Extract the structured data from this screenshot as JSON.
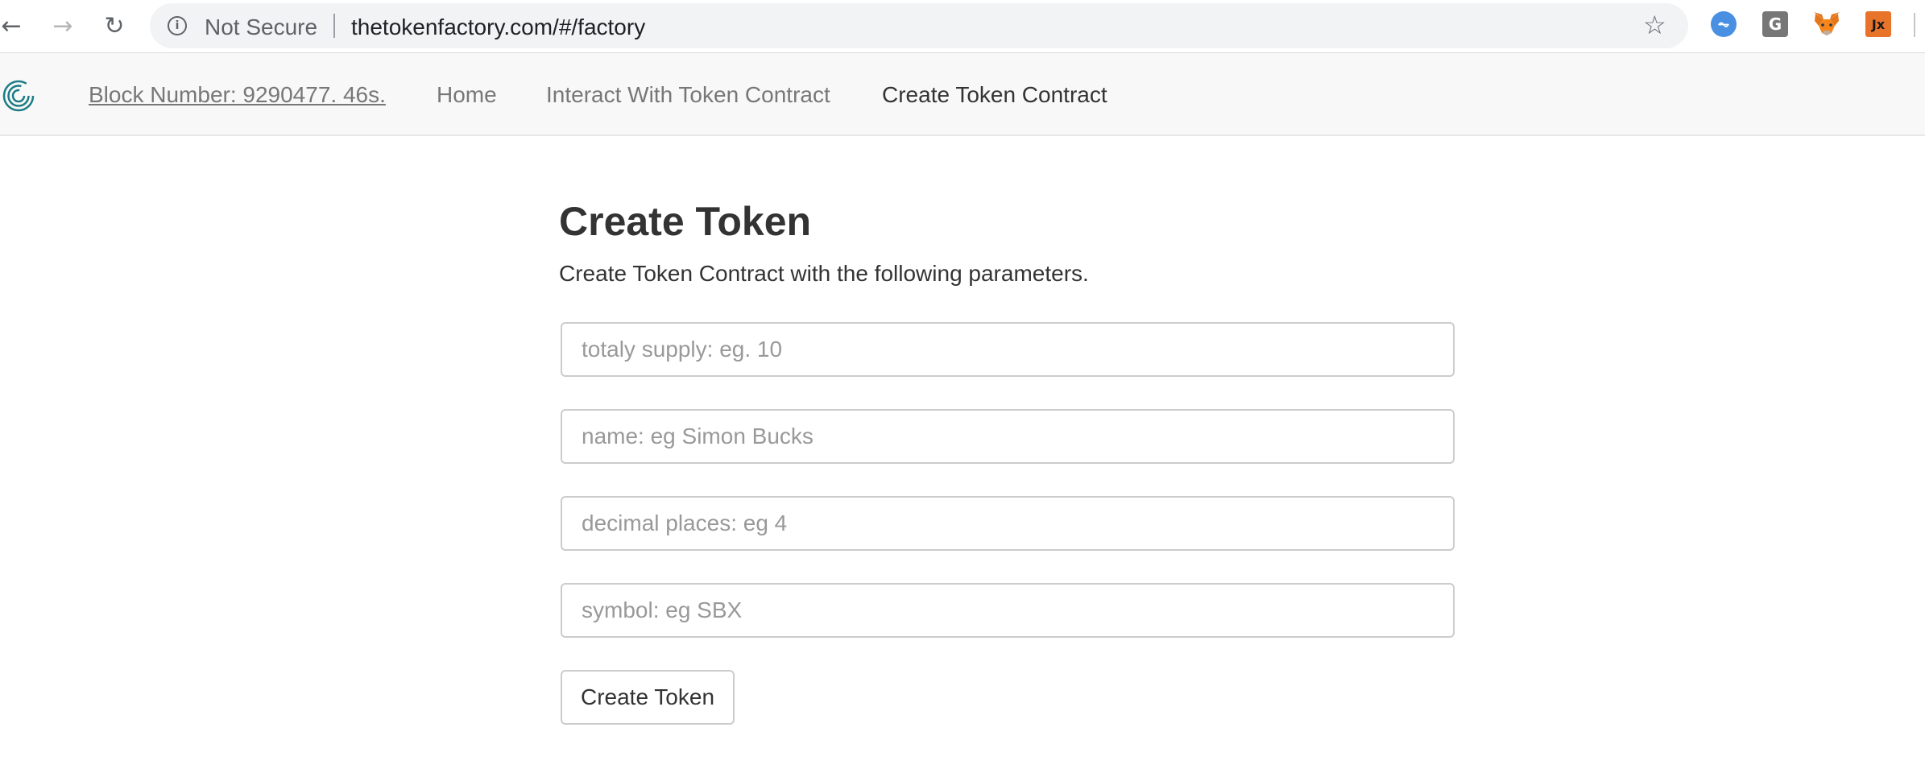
{
  "browser": {
    "back_icon": "←",
    "forward_icon": "→",
    "reload_icon": "↻",
    "security_label": "Not Secure",
    "url": "thetokenfactory.com/#/factory",
    "star_icon": "☆",
    "extensions": [
      {
        "name": "pulse-extension",
        "glyph": "⏦"
      },
      {
        "name": "grammarly-extension",
        "glyph": "G"
      },
      {
        "name": "metamask-extension",
        "glyph": ""
      },
      {
        "name": "jx-extension",
        "glyph": "Jx"
      }
    ]
  },
  "navbar": {
    "block_number": "Block Number: 9290477. 46s.",
    "links": [
      {
        "label": "Home"
      },
      {
        "label": "Interact With Token Contract"
      },
      {
        "label": "Create Token Contract"
      }
    ]
  },
  "form": {
    "title": "Create Token",
    "subtitle": "Create Token Contract with the following parameters.",
    "fields": [
      {
        "placeholder": "totaly supply: eg. 10"
      },
      {
        "placeholder": "name: eg Simon Bucks"
      },
      {
        "placeholder": "decimal places: eg 4"
      },
      {
        "placeholder": "symbol: eg SBX"
      }
    ],
    "submit_label": "Create Token"
  },
  "colors": {
    "navbar_bg": "#f8f8f8",
    "link_color": "#777777",
    "text_color": "#333333",
    "logo_color": "#1c7c86",
    "metamask_orange": "#e2761b",
    "pulse_blue": "#4a90e2",
    "jx_orange": "#e8732b"
  }
}
